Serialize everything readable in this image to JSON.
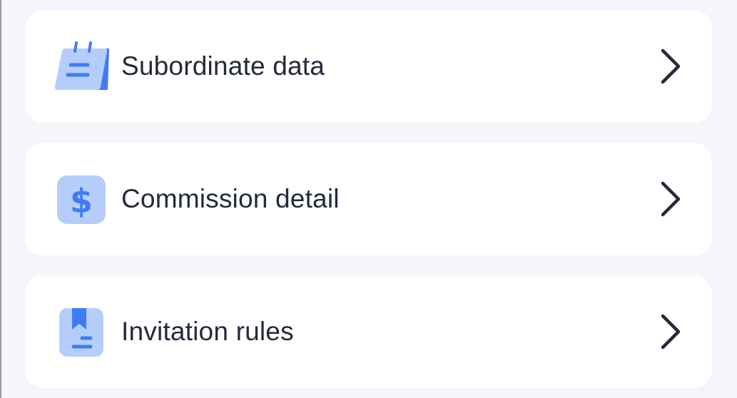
{
  "menu": {
    "items": [
      {
        "label": "Subordinate data",
        "icon": "calendar-note-icon"
      },
      {
        "label": "Commission detail",
        "icon": "dollar-icon"
      },
      {
        "label": "Invitation rules",
        "icon": "bookmark-document-icon"
      }
    ]
  },
  "colors": {
    "background": "#f5f6fc",
    "card": "#ffffff",
    "text": "#232a3b",
    "icon_light": "#b4cdfa",
    "icon_accent": "#3f7cf2",
    "chevron": "#232a3b"
  }
}
